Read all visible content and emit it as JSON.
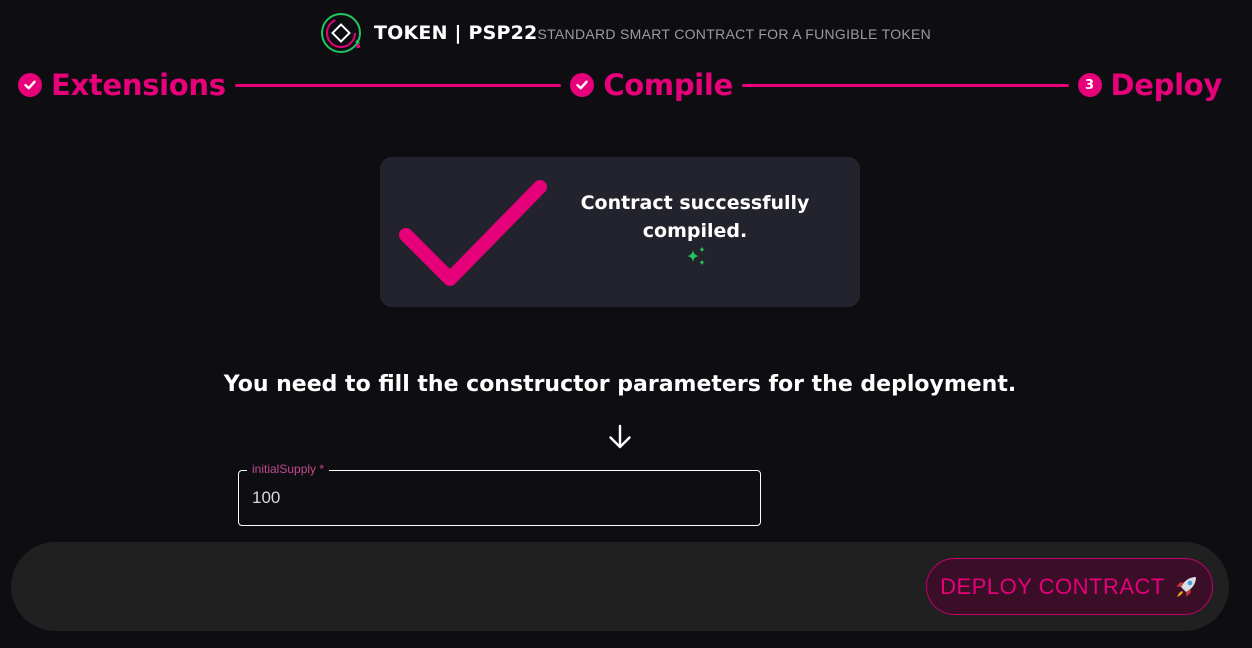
{
  "header": {
    "brand": "TOKEN | PSP22",
    "subtitle": "STANDARD SMART CONTRACT FOR A FUNGIBLE TOKEN",
    "logo_icon": "token-logo-icon"
  },
  "stepper": {
    "steps": [
      {
        "label": "Extensions",
        "status": "completed",
        "icon": "check-circle-icon"
      },
      {
        "label": "Compile",
        "status": "completed",
        "icon": "check-circle-icon"
      },
      {
        "label": "Deploy",
        "status": "active",
        "number": "3"
      }
    ]
  },
  "success_card": {
    "message": "Contract successfully compiled.",
    "icon": "large-checkmark-icon",
    "decoration_icon": "sparkles-icon"
  },
  "instruction": {
    "text": "You need to fill the constructor parameters for the deployment.",
    "icon": "arrow-down-icon"
  },
  "form": {
    "initial_supply": {
      "label": "initialSupply *",
      "value": "100"
    }
  },
  "footer": {
    "deploy_button_label": "DEPLOY CONTRACT",
    "deploy_button_icon": "rocket-icon"
  },
  "colors": {
    "accent": "#e6007a",
    "background": "#0e0e12",
    "card": "#22232c",
    "footer": "#202020",
    "sparkle": "#22c55e"
  }
}
